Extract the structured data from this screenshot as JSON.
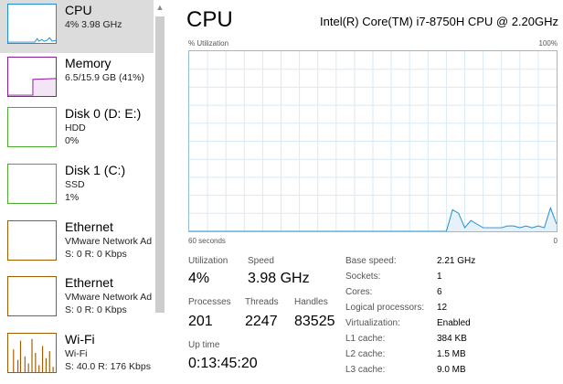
{
  "colors": {
    "cpu_accent": "#1f8fd0",
    "memory_accent": "#8b1b9c",
    "disk_accent": "#4caa2e",
    "ethernet_accent": "#a05a00",
    "selected_bg": "#dcdcdc"
  },
  "sidebar": {
    "items": [
      {
        "title": "CPU",
        "lines": [
          "4%  3.98 GHz"
        ],
        "icon": "cpu-graph-thumbnail"
      },
      {
        "title": "Memory",
        "lines": [
          "6.5/15.9 GB (41%)"
        ],
        "icon": "memory-graph-thumbnail"
      },
      {
        "title": "Disk 0 (D: E:)",
        "lines": [
          "HDD",
          "0%"
        ],
        "icon": "disk-graph-thumbnail"
      },
      {
        "title": "Disk 1 (C:)",
        "lines": [
          "SSD",
          "1%"
        ],
        "icon": "disk-graph-thumbnail"
      },
      {
        "title": "Ethernet",
        "lines": [
          "VMware Network Ad",
          "S: 0  R: 0 Kbps"
        ],
        "icon": "ethernet-graph-thumbnail"
      },
      {
        "title": "Ethernet",
        "lines": [
          "VMware Network Ad",
          "S: 0  R: 0 Kbps"
        ],
        "icon": "ethernet-graph-thumbnail"
      },
      {
        "title": "Wi-Fi",
        "lines": [
          "Wi-Fi",
          "S: 40.0  R: 176 Kbps"
        ],
        "icon": "wifi-graph-thumbnail"
      }
    ]
  },
  "main": {
    "title": "CPU",
    "model": "Intel(R) Core(TM) i7-8750H CPU @ 2.20GHz",
    "graph": {
      "y_label": "% Utilization",
      "y_max_label": "100%",
      "x_left_label": "60 seconds",
      "x_right_label": "0"
    },
    "stats": {
      "utilization_label": "Utilization",
      "utilization": "4%",
      "speed_label": "Speed",
      "speed": "3.98 GHz",
      "processes_label": "Processes",
      "processes": "201",
      "threads_label": "Threads",
      "threads": "2247",
      "handles_label": "Handles",
      "handles": "83525",
      "uptime_label": "Up time",
      "uptime": "0:13:45:20"
    },
    "specs": [
      {
        "label": "Base speed:",
        "value": "2.21 GHz"
      },
      {
        "label": "Sockets:",
        "value": "1"
      },
      {
        "label": "Cores:",
        "value": "6"
      },
      {
        "label": "Logical processors:",
        "value": "12"
      },
      {
        "label": "Virtualization:",
        "value": "Enabled"
      },
      {
        "label": "L1 cache:",
        "value": "384 KB"
      },
      {
        "label": "L2 cache:",
        "value": "1.5 MB"
      },
      {
        "label": "L3 cache:",
        "value": "9.0 MB"
      }
    ]
  },
  "chart_data": {
    "type": "area",
    "ylim": [
      0,
      100
    ],
    "grid": true,
    "series": [
      {
        "values": [
          0,
          0,
          0,
          0,
          0,
          0,
          0,
          0,
          0,
          0,
          0,
          0,
          0,
          0,
          0,
          0,
          0,
          0,
          0,
          0,
          0,
          0,
          0,
          0,
          0,
          0,
          0,
          0,
          0,
          0,
          0,
          0,
          0,
          0,
          0,
          0,
          0,
          0,
          0,
          0,
          0,
          0,
          0,
          12,
          10,
          2,
          6,
          4,
          2,
          2,
          2,
          2,
          3,
          3,
          2,
          3,
          2,
          3,
          2,
          13,
          4
        ]
      }
    ]
  }
}
